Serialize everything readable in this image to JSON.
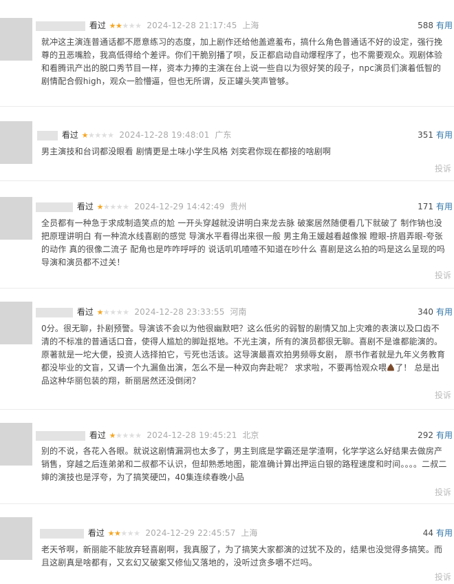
{
  "reviews": [
    {
      "watched": "看过",
      "stars": 2,
      "time": "2024-12-28 21:17:45",
      "location": "上海",
      "votes": "588",
      "useful_label": "有用",
      "content": "就冲这主演连普通话都不愿意练习的态度，加上剧作还给他盖遮羞布，搞什么角色普通话不好的设定，强行挽尊的丑恶嘴脸，我高低得给个差评。你们干脆别播了呗，反正都启动自动爆程序了，也不需要观众。观剧体验和看腾讯产出的脱口秀节目一样，资本力捧的主演在台上说一些自以为很好笑的段子，npc演员们演着低智的剧情配合假high，观众一脸懵逼，但也无所谓，反正罐头笑声管够。",
      "report": ""
    },
    {
      "watched": "看过",
      "stars": 1,
      "time": "2024-12-28 19:48:01",
      "location": "广东",
      "votes": "351",
      "useful_label": "有用",
      "content": "男主演技和台词都没眼看 剧情更是土味小学生风格 刘奕君你现在都接的啥剧啊",
      "report": "投诉"
    },
    {
      "watched": "看过",
      "stars": 1,
      "time": "2024-12-29 14:42:49",
      "location": "贵州",
      "votes": "171",
      "useful_label": "有用",
      "content": "全员都有一种急于求成制造笑点的尬 一开头穿越就没讲明白来龙去脉 破案居然随便看几下就破了 制作钠也没把原理讲明白 有一种流水线喜剧的感觉 导演水平看得出来很一般 男主角王媛越看越像猴 瞪眼-挤眉弄眼-夸张的动作 真的很像二流子 配角也是咋咋呼呼的 说话叽叽喳喳不知道在吵什么 喜剧是这么拍的吗是这么呈现的吗 导演和演员都不过关！",
      "report": "投诉"
    },
    {
      "watched": "看过",
      "stars": 1,
      "time": "2024-12-28 23:33:55",
      "location": "河南",
      "votes": "340",
      "useful_label": "有用",
      "content": "0分。很无聊，扑剧预警。导演该不会以为他很幽默吧？这么低劣的弱智的剧情又加上灾难的表演以及口齿不清的不标准的普通话口音，使得人尴尬的脚趾抠地。不光主演，所有的演员都很无聊。喜剧不是谁都能演的。 原著就是一坨大便，投资人选择拍它，亏死也活该。这导演最喜欢拍男频辱女剧， 原书作者就是九年义务教育都没毕业的文盲，又请一个九漏鱼出演，怎么不是一种双向奔赴呢？ 求求啦，不要再恰观众喂",
      "content_tail": "了！ 总是出品这种华丽包装的翔，新丽居然还没倒闭？",
      "poop_icon": "poop-emoji",
      "report": "投诉"
    },
    {
      "watched": "看过",
      "stars": 1,
      "time": "2024-12-28 19:45:21",
      "location": "北京",
      "votes": "292",
      "useful_label": "有用",
      "content": "别的不说，各花入各眼。就说这剧情漏洞也太多了，男主到底是学霸还是学渣啊，化学学这么好结果去做房产销售，穿越之后连弟弟和二叔都不认识，但却熟悉地图，能准确计算出押运白银的路程速度和时间。。。。二叔二婶的演技也是浮夸，为了搞笑硬凹，40集连续春晚小品",
      "report": "投诉"
    },
    {
      "watched": "看过",
      "stars": 2,
      "time": "2024-12-29 22:45:57",
      "location": "上海",
      "votes": "44",
      "useful_label": "有用",
      "content": "老天爷啊，新丽能不能放弃轻喜剧啊，我真服了，为了搞笑大家都演的过犹不及的，结果也没觉得多搞笑。而且这剧真是啥都有，又玄幻又破案又修仙又落地的，没听过贪多嚼不烂吗。",
      "report": "投诉"
    }
  ]
}
